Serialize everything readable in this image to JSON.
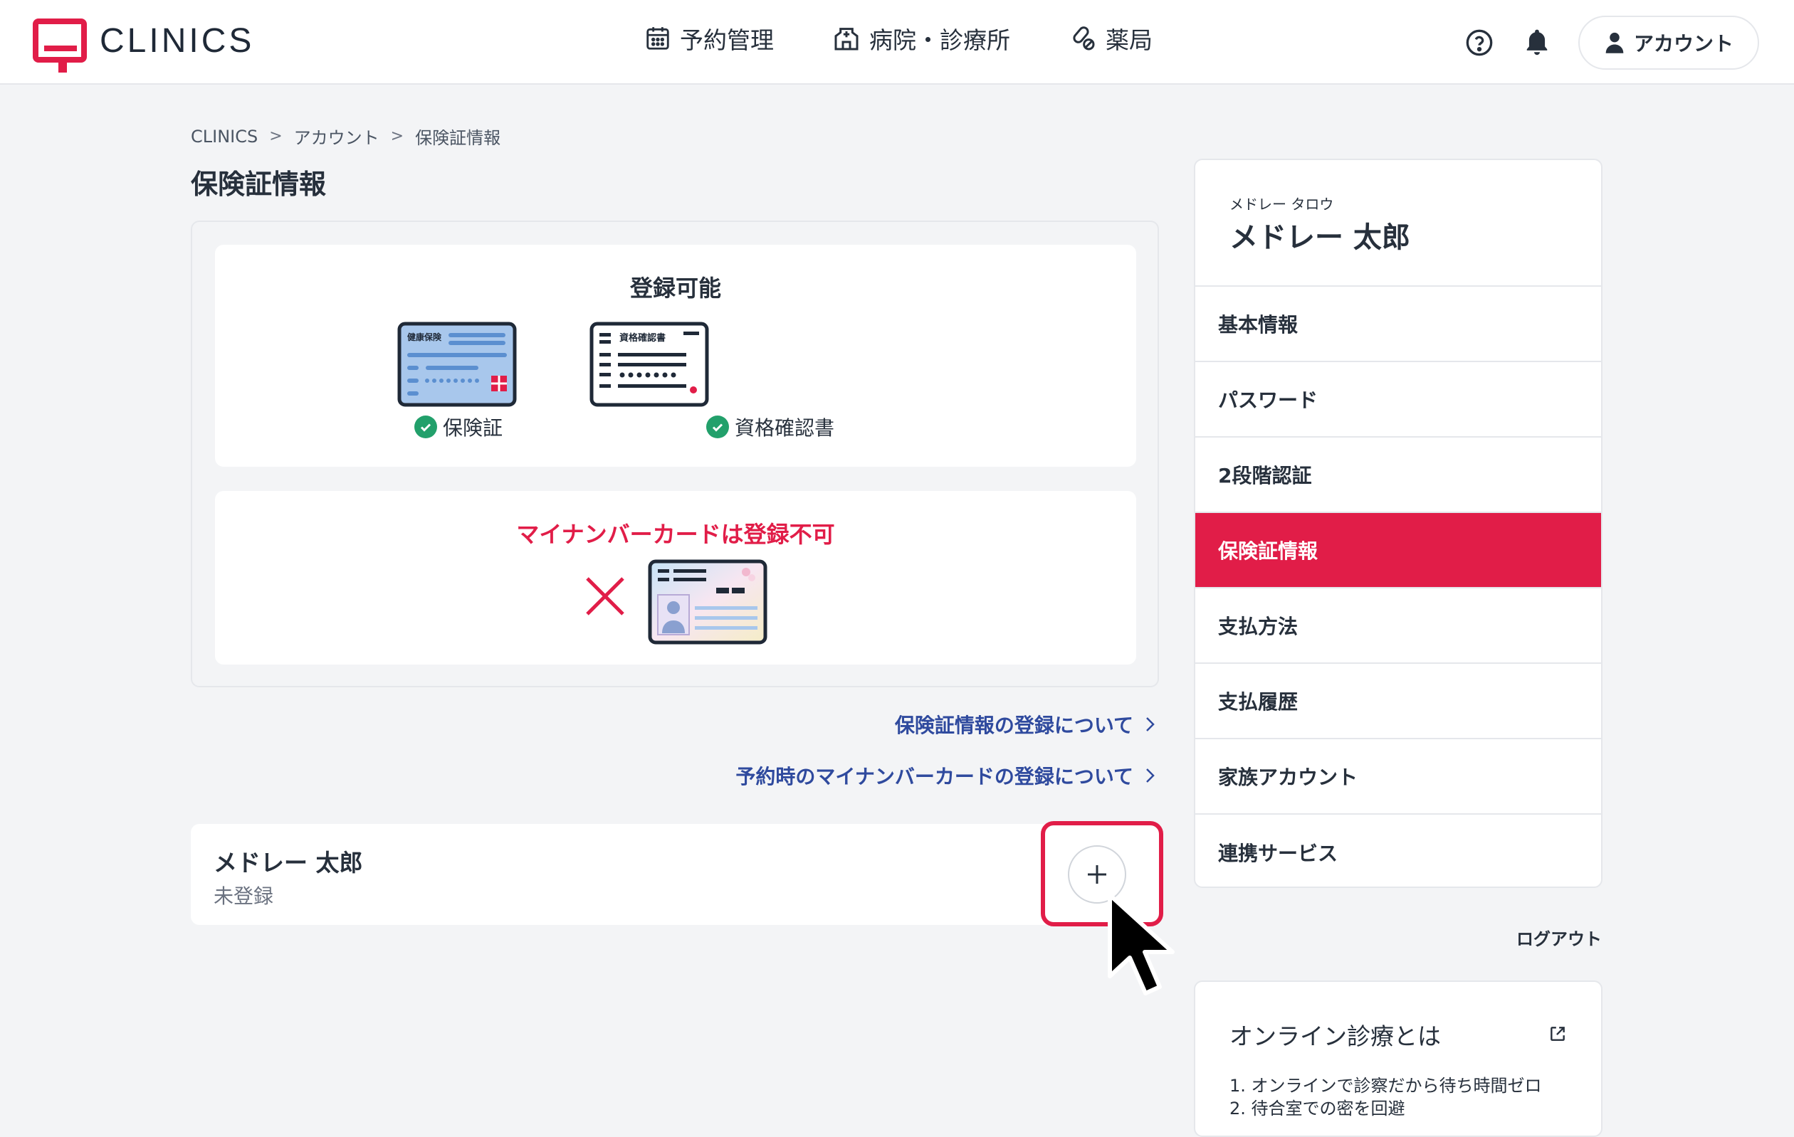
{
  "brand": {
    "name": "CLINICS",
    "color": "#e11d48"
  },
  "header": {
    "nav": [
      {
        "label": "予約管理",
        "icon": "calendar-icon"
      },
      {
        "label": "病院・診療所",
        "icon": "hospital-icon"
      },
      {
        "label": "薬局",
        "icon": "pill-icon"
      }
    ],
    "account_label": "アカウント"
  },
  "breadcrumb": [
    "CLINICS",
    "アカウント",
    "保険証情報"
  ],
  "page_title": "保険証情報",
  "registrable": {
    "title": "登録可能",
    "cards": [
      {
        "label": "保険証",
        "card_text": "健康保険"
      },
      {
        "label": "資格確認書",
        "card_text": "資格確認書"
      }
    ]
  },
  "not_registrable": {
    "title": "マイナンバーカードは登録不可"
  },
  "links": {
    "insurance_registration": "保険証情報の登録について",
    "mynumber_registration": "予約時のマイナンバーカードの登録について"
  },
  "member": {
    "name": "メドレー 太郎",
    "status": "未登録"
  },
  "sidebar": {
    "profile_kana": "メドレー タロウ",
    "profile_name": "メドレー 太郎",
    "items": [
      {
        "label": "基本情報",
        "active": false
      },
      {
        "label": "パスワード",
        "active": false
      },
      {
        "label": "2段階認証",
        "active": false
      },
      {
        "label": "保険証情報",
        "active": true
      },
      {
        "label": "支払方法",
        "active": false
      },
      {
        "label": "支払履歴",
        "active": false
      },
      {
        "label": "家族アカウント",
        "active": false
      },
      {
        "label": "連携サービス",
        "active": false
      }
    ],
    "logout_label": "ログアウト"
  },
  "online_card": {
    "title": "オンライン診療とは",
    "lines": [
      "1. オンラインで診察だから待ち時間ゼロ",
      "2. 待合室での密を回避"
    ]
  }
}
